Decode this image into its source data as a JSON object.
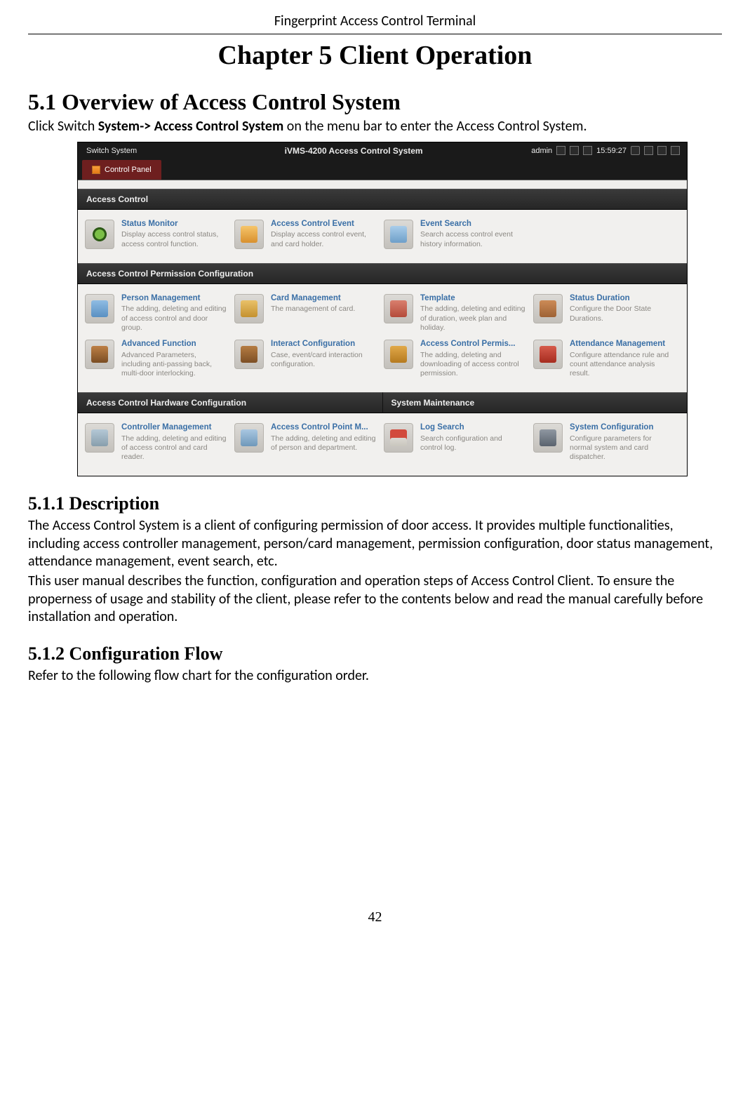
{
  "doc_header": "Fingerprint Access Control Terminal",
  "chapter_title": "Chapter 5    Client Operation",
  "section_5_1_title": "5.1 Overview of Access Control System",
  "intro_prefix": "Click Switch ",
  "intro_bold": "System-> Access Control System",
  "intro_suffix": " on the menu bar to enter the Access Control System.",
  "subsection_5_1_1_title": "5.1.1   Description",
  "para_5_1_1_a": "The Access Control System is a client of configuring permission of door access. It provides multiple functionalities, including access controller management, person/card management, permission configuration, door status management, attendance management, event search, etc.",
  "para_5_1_1_b": "This user manual describes the function, configuration and operation steps of Access Control Client. To ensure the properness of usage and stability of the client, please refer to the contents below and read the manual carefully before installation and operation.",
  "subsection_5_1_2_title": "5.1.2   Configuration Flow",
  "para_5_1_2": "Refer to the following flow chart for the configuration order.",
  "page_number": "42",
  "shot": {
    "titlebar": {
      "switch_system": "Switch System",
      "app_title": "iVMS-4200  Access Control System",
      "user": "admin",
      "time": "15:59:27"
    },
    "tab_label": "Control Panel",
    "section_access_control": "Access Control",
    "section_permission": "Access Control Permission Configuration",
    "section_hardware": "Access Control Hardware Configuration",
    "section_maintenance": "System Maintenance",
    "tiles": {
      "status_monitor": {
        "title": "Status Monitor",
        "desc": "Display access control status, access control function."
      },
      "ac_event": {
        "title": "Access Control Event",
        "desc": "Display access control event, and card holder."
      },
      "event_search": {
        "title": "Event Search",
        "desc": "Search access control event history information."
      },
      "person_mgmt": {
        "title": "Person Management",
        "desc": "The adding, deleting and editing of access control and door group."
      },
      "card_mgmt": {
        "title": "Card Management",
        "desc": "The management of card."
      },
      "template": {
        "title": "Template",
        "desc": "The adding, deleting and editing of duration, week plan and holiday."
      },
      "status_dur": {
        "title": "Status Duration",
        "desc": "Configure the Door State Durations."
      },
      "adv_func": {
        "title": "Advanced Function",
        "desc": "Advanced Parameters, including anti-passing back, multi-door interlocking."
      },
      "interact": {
        "title": "Interact Configuration",
        "desc": "Case, event/card interaction configuration."
      },
      "ac_permis": {
        "title": "Access Control Permis...",
        "desc": "The adding, deleting and downloading of access control permission."
      },
      "attendance": {
        "title": "Attendance Management",
        "desc": "Configure attendance rule and count attendance analysis result."
      },
      "controller": {
        "title": "Controller Management",
        "desc": "The adding, deleting and editing of access control and card reader."
      },
      "point_mgmt": {
        "title": "Access Control Point M...",
        "desc": "The adding, deleting and editing of person and department."
      },
      "log_search": {
        "title": "Log Search",
        "desc": "Search configuration and control log."
      },
      "sys_config": {
        "title": "System Configuration",
        "desc": "Configure parameters for normal system and card dispatcher."
      }
    }
  }
}
